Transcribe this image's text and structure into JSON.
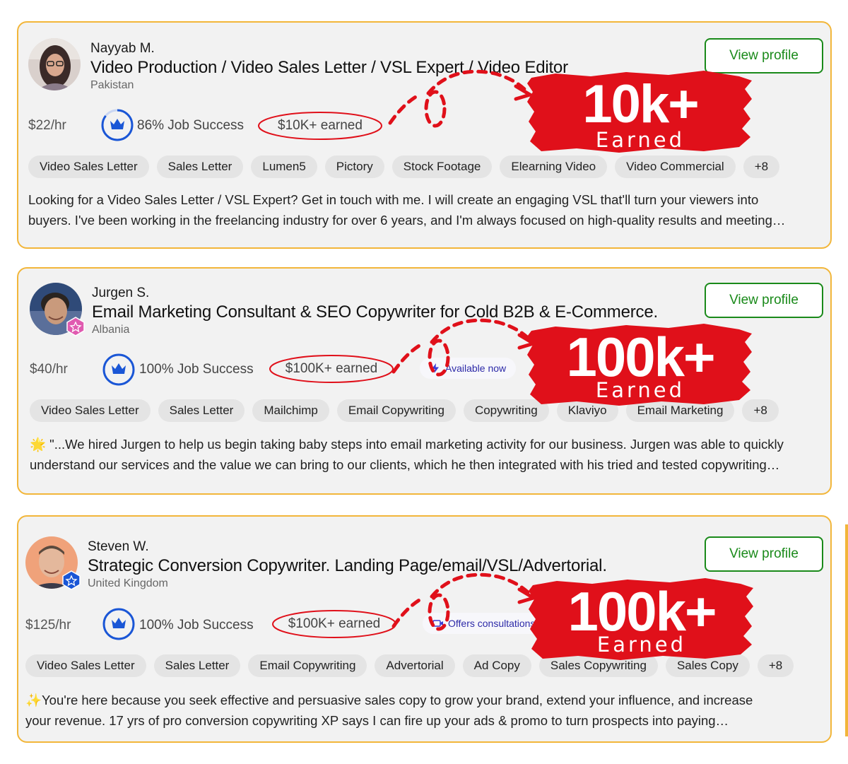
{
  "accent_colors": {
    "upwork_green": "#1a8a1a",
    "card_border": "#f2b63a",
    "annotation_red": "#e0101a",
    "badge_blue": "#1a56d6"
  },
  "freelancers": [
    {
      "name": "Nayyab M.",
      "title": "Video Production / Video Sales Letter / VSL Expert / Video Editor",
      "country": "Pakistan",
      "rate": "$22/hr",
      "job_success": "86% Job Success",
      "earned": "$10K+ earned",
      "availability": "",
      "view_profile": "View profile",
      "skills": [
        "Video Sales Letter",
        "Sales Letter",
        "Lumen5",
        "Pictory",
        "Stock Footage",
        "Elearning Video",
        "Video Commercial",
        "+8"
      ],
      "description": [
        "Looking for a Video Sales Letter / VSL Expert? Get in touch with me. I will create an engaging VSL that'll turn your viewers into",
        "buyers. I've been working in the freelancing industry for over 6 years, and I'm always focused on high-quality results and meeting…"
      ],
      "promo_big": "10k+",
      "promo_small": "Earned",
      "avatar_icon": "woman-portrait-icon"
    },
    {
      "name": "Jurgen S.",
      "title": "Email Marketing Consultant & SEO Copywriter for Cold B2B & E-Commerce.",
      "country": "Albania",
      "rate": "$40/hr",
      "job_success": "100% Job Success",
      "earned": "$100K+ earned",
      "availability": "Available now",
      "view_profile": "View profile",
      "skills": [
        "Video Sales Letter",
        "Sales Letter",
        "Mailchimp",
        "Email Copywriting",
        "Copywriting",
        "Klaviyo",
        "Email Marketing",
        "+8"
      ],
      "description": [
        "🌟 \"...We hired Jurgen to help us begin taking baby steps into email marketing activity for our business. Jurgen was able to quickly",
        "understand our services and the value we can bring to our clients, which he then integrated with his tried and tested copywriting…"
      ],
      "promo_big": "100k+",
      "promo_small": "Earned",
      "avatar_icon": "man-portrait-icon"
    },
    {
      "name": "Steven W.",
      "title": "Strategic Conversion Copywriter. Landing Page/email/VSL/Advertorial.",
      "country": "United Kingdom",
      "rate": "$125/hr",
      "job_success": "100% Job Success",
      "earned": "$100K+ earned",
      "availability": "Offers consultations",
      "view_profile": "View profile",
      "skills": [
        "Video Sales Letter",
        "Sales Letter",
        "Email Copywriting",
        "Advertorial",
        "Ad Copy",
        "Sales Copywriting",
        "Sales Copy",
        "+8"
      ],
      "description": [
        "✨You're here because you seek effective and persuasive sales copy to grow your brand, extend your influence, and increase",
        "your revenue. 17 yrs of pro conversion copywriting XP says I can fire up your ads & promo to turn prospects into paying…"
      ],
      "promo_big": "100k+",
      "promo_small": "Earned",
      "avatar_icon": "man-portrait-icon"
    }
  ]
}
